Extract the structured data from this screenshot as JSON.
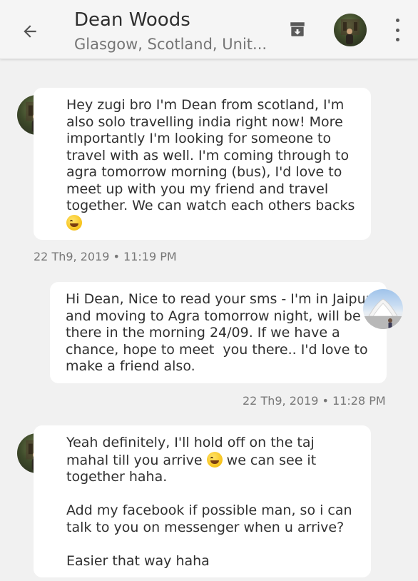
{
  "header": {
    "name": "Dean Woods",
    "location": "Glasgow, Scotland, Unit..."
  },
  "messages": [
    {
      "sender": "Dean",
      "text": "Hey zugi bro I'm Dean from scotland, I'm also solo travelling india right now! More importantly I'm looking for someone to travel with as well. I'm coming through to agra tomorrow morning (bus), I'd love to meet up with you my friend and travel together. We can watch each others backs",
      "emoji": "laughing-emoji",
      "timestamp": "22 Th9, 2019 • 11:19 PM"
    },
    {
      "sender": "me",
      "text": "Hi Dean, Nice to read your sms - I'm in Jaipur and moving to Agra tomorrow night, will be there in the morning 24/09. If we have a chance, hope to meet  you there.. I'd love to make a friend also.",
      "timestamp": "22 Th9, 2019 • 11:28 PM"
    },
    {
      "sender": "Dean",
      "text_before_emoji": "Yeah definitely, I'll hold off on the taj mahal till you arrive ",
      "emoji": "winking-emoji",
      "text_after_emoji": " we can see it together haha.\n\nAdd my facebook if possible man, so i can talk to you on messenger when u arrive?\n\nEasier that way haha"
    }
  ],
  "colors": {
    "background": "#f1f1f1",
    "bubble": "#ffffff",
    "header": "#f5f5f5"
  },
  "icons": [
    "back-arrow-icon",
    "archive-icon",
    "more-options-icon"
  ]
}
